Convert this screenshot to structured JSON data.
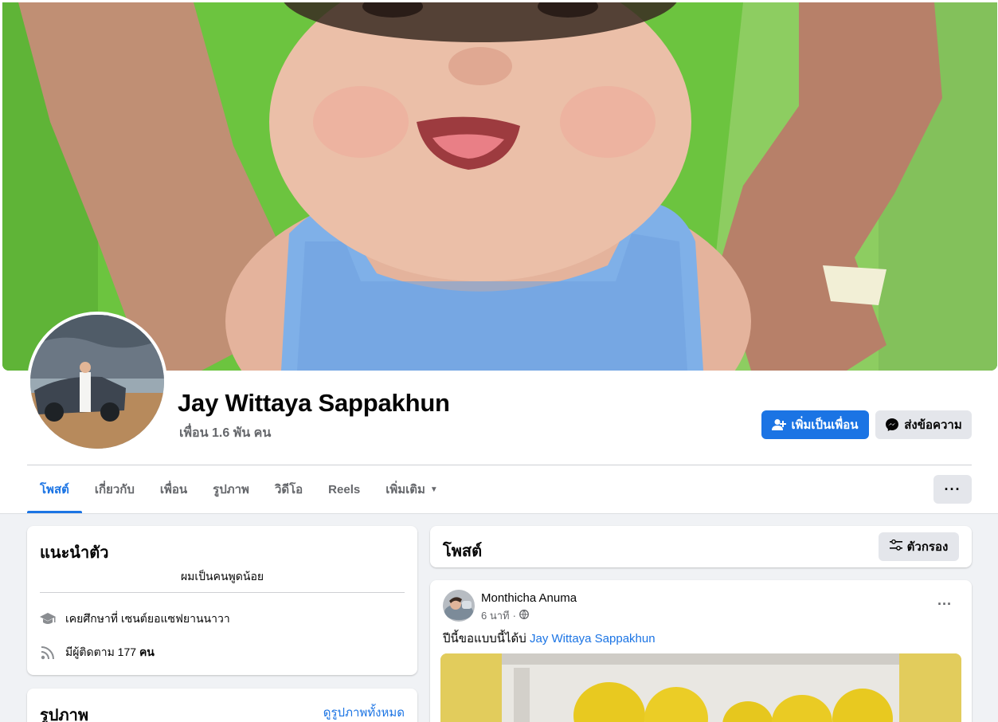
{
  "profile": {
    "name": "Jay Wittaya Sappakhun",
    "friends": "เพื่อน 1.6 พัน คน"
  },
  "actions": {
    "add_friend": "เพิ่มเป็นเพื่อน",
    "message": "ส่งข้อความ"
  },
  "tabs": [
    {
      "label": "โพสต์",
      "active": true
    },
    {
      "label": "เกี่ยวกับ"
    },
    {
      "label": "เพื่อน"
    },
    {
      "label": "รูปภาพ"
    },
    {
      "label": "วิดีโอ"
    },
    {
      "label": "Reels"
    },
    {
      "label": "เพิ่มเติม"
    }
  ],
  "intro": {
    "title": "แนะนำตัว",
    "bio": "ผมเป็นคนพูดน้อย",
    "education": "เคยศึกษาที่ เซนต์ยอแซฟยานนาวา",
    "followers_prefix": "มีผู้ติดตาม 177",
    "followers_suffix": "คน"
  },
  "photos": {
    "title": "รูปภาพ",
    "see_all": "ดูรูปภาพทั้งหมด"
  },
  "posts": {
    "title": "โพสต์",
    "filter": "ตัวกรอง"
  },
  "post": {
    "author": "Monthicha Anuma",
    "time": "6 นาที",
    "separator": "·",
    "text": "ปีนี้ขอแบบนี้ได้บ่",
    "mention": "Jay Wittaya Sappakhun"
  },
  "colors": {
    "accent": "#1b74e4",
    "secondary_text": "#65676b",
    "page_bg": "#f0f2f5",
    "button_gray": "#e4e6eb"
  },
  "icons": {
    "add_friend": "user-plus-icon",
    "message": "messenger-icon",
    "more": "ellipsis-icon",
    "filter": "sliders-icon",
    "education": "graduation-cap-icon",
    "followers": "rss-icon",
    "privacy": "globe-icon"
  }
}
